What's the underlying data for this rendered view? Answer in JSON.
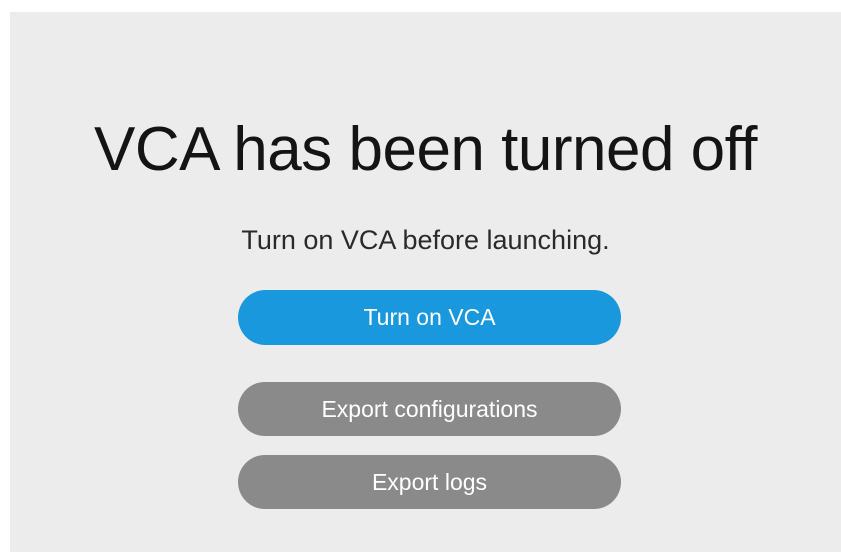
{
  "dialog": {
    "title": "VCA has been turned off",
    "subtitle": "Turn on VCA before launching.",
    "buttons": {
      "turn_on": "Turn on VCA",
      "export_configurations": "Export configurations",
      "export_logs": "Export logs"
    }
  },
  "colors": {
    "panel_background": "#ececec",
    "primary_button": "#1a98dd",
    "secondary_button": "#8a8a8a",
    "button_text": "#ffffff",
    "title_text": "#141414"
  }
}
